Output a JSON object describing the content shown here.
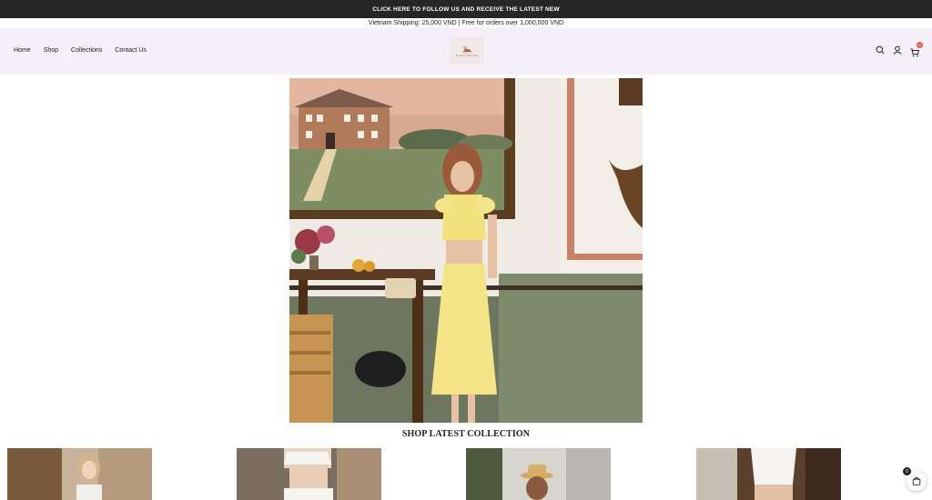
{
  "announcement": {
    "text": "CLICK HERE TO FOLLOW US AND RECEIVE THE LATEST NEW"
  },
  "shipping": {
    "text": "Vietnam Shipping: 25,000 VND | Free for orders over 1,000,000 VND"
  },
  "nav": {
    "items": [
      "Home",
      "Shop",
      "Collections",
      "Contact Us"
    ]
  },
  "logo": {
    "text": "Moon in a silver dream"
  },
  "header": {
    "cart_count": "0",
    "icons": [
      "search-icon",
      "account-icon",
      "cart-icon"
    ]
  },
  "section": {
    "title": "SHOP LATEST COLLECTION"
  },
  "floating_cart": {
    "count": "0",
    "icon": "shopping-bag-icon"
  },
  "colors": {
    "topbar": "#262626",
    "header_bg": "#f5eff7",
    "badge": "#e4574f"
  }
}
